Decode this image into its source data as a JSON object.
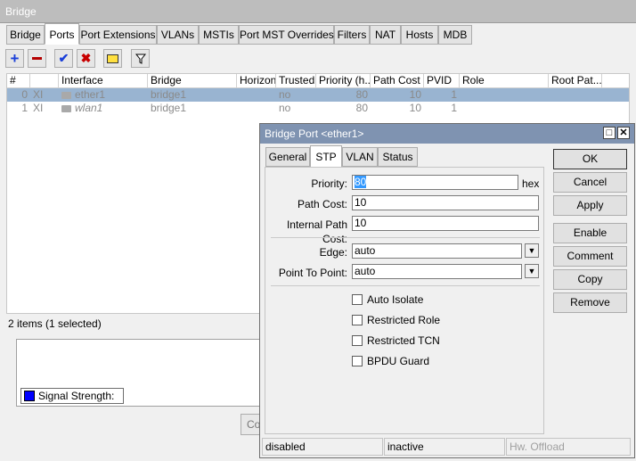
{
  "window": {
    "title": "Bridge"
  },
  "tabs": [
    "Bridge",
    "Ports",
    "Port Extensions",
    "VLANs",
    "MSTIs",
    "Port MST Overrides",
    "Filters",
    "NAT",
    "Hosts",
    "MDB"
  ],
  "toolbar_icons": [
    "add-icon",
    "remove-icon",
    "enable-icon",
    "disable-icon",
    "comment-icon",
    "filter-icon"
  ],
  "table": {
    "columns": [
      "#",
      "",
      "Interface",
      "Bridge",
      "Horizon",
      "Trusted",
      "Priority (h...",
      "Path Cost",
      "PVID",
      "Role",
      "Root Pat..."
    ],
    "rows": [
      {
        "num": "0",
        "flags": "XI",
        "interface": "ether1",
        "bridge": "bridge1",
        "horizon": "",
        "trusted": "no",
        "priority": "80",
        "path_cost": "10",
        "pvid": "1",
        "role": "",
        "root_path": ""
      },
      {
        "num": "1",
        "flags": "XI",
        "interface": "wlan1",
        "bridge": "bridge1",
        "horizon": "",
        "trusted": "no",
        "priority": "80",
        "path_cost": "10",
        "pvid": "1",
        "role": "",
        "root_path": ""
      }
    ],
    "selected_row": 0
  },
  "status": {
    "items": "2 items (1 selected)"
  },
  "lower_panel": {
    "signal_label": "Signal Strength:",
    "signal_color": "#0000ff",
    "button_partial": "Co"
  },
  "dialog": {
    "title": "Bridge Port <ether1>",
    "tabs": [
      "General",
      "STP",
      "VLAN",
      "Status"
    ],
    "active_tab": "STP",
    "fields": {
      "priority_label": "Priority:",
      "priority_value": "80",
      "priority_unit": "hex",
      "path_cost_label": "Path Cost:",
      "path_cost_value": "10",
      "internal_path_cost_label": "Internal Path Cost:",
      "internal_path_cost_value": "10",
      "edge_label": "Edge:",
      "edge_value": "auto",
      "ptp_label": "Point To Point:",
      "ptp_value": "auto"
    },
    "checkboxes": [
      {
        "label": "Auto Isolate",
        "checked": false
      },
      {
        "label": "Restricted Role",
        "checked": false
      },
      {
        "label": "Restricted TCN",
        "checked": false
      },
      {
        "label": "BPDU Guard",
        "checked": false
      }
    ],
    "buttons": [
      "OK",
      "Cancel",
      "Apply",
      "Enable",
      "Comment",
      "Copy",
      "Remove"
    ],
    "status": [
      "disabled",
      "inactive",
      "Hw. Offload"
    ]
  },
  "colors": {
    "selected_row": "#99b4d1",
    "dialog_title": "#7f93b1",
    "add": "#1a3fd9",
    "remove": "#b40000"
  }
}
